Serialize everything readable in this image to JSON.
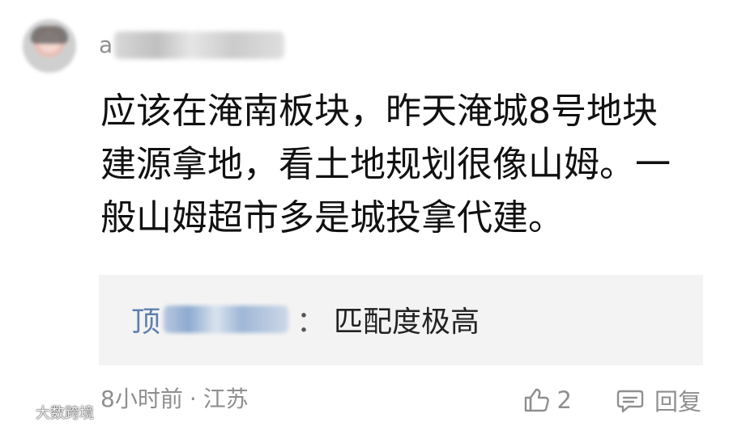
{
  "comment": {
    "author_visible": "a",
    "text": "应该在淹南板块，昨天淹城8号地块建源拿地，看土地规划很像山姆。一般山姆超市多是城投拿代建。",
    "quoted_reply": {
      "author_visible": "顶",
      "separator": "：",
      "content": "匹配度极高"
    },
    "meta": {
      "time": "8小时前",
      "dot": "·",
      "location": "江苏"
    },
    "actions": {
      "like_count": "2",
      "reply_label": "回复"
    }
  },
  "watermark": {
    "text": "大数跨境"
  },
  "icons": {
    "avatar": "user-avatar",
    "like": "thumbs-up-icon",
    "reply": "comment-icon",
    "watermark": "logo-mark"
  },
  "colors": {
    "body_text": "#111111",
    "muted_text": "#8f8f8f",
    "quote_background": "#f3f3f3",
    "reply_user": "#5f7fae"
  }
}
